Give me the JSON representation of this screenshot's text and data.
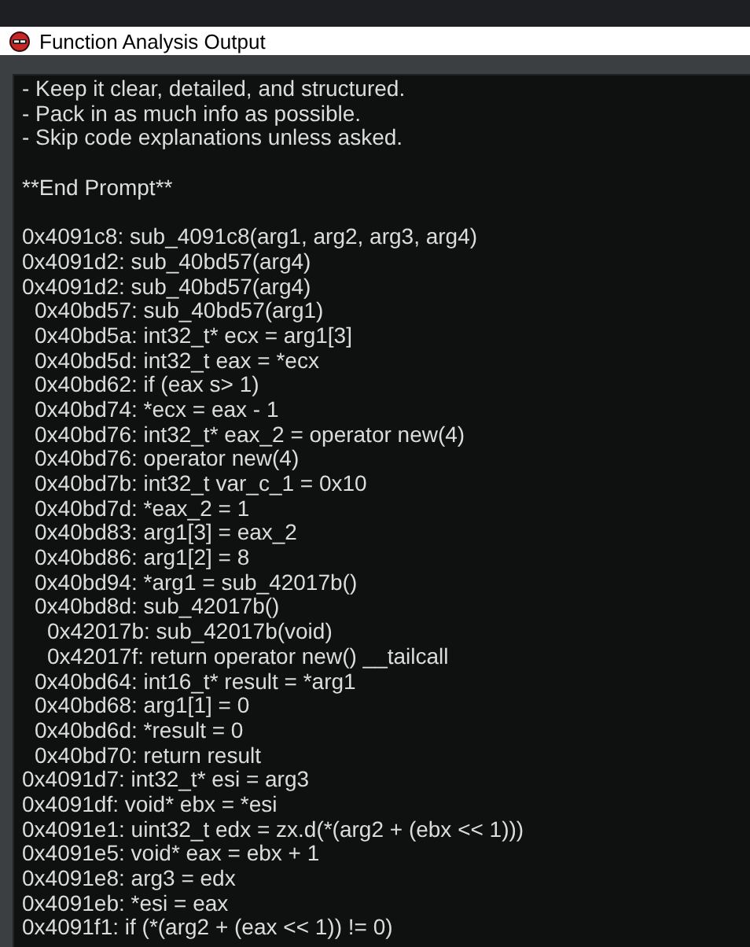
{
  "window": {
    "title": "Function Analysis Output"
  },
  "prompt_lines": [
    "- Keep it clear, detailed, and structured.",
    "- Pack in as much info as possible.",
    "- Skip code explanations unless asked."
  ],
  "end_marker": "**End Prompt**",
  "trace": [
    {
      "text": "0x4091c8: sub_4091c8(arg1, arg2, arg3, arg4)"
    },
    {
      "text": "0x4091d2: sub_40bd57(arg4)"
    },
    {
      "text": "0x4091d2: sub_40bd57(arg4)",
      "children": [
        {
          "text": "0x40bd57: sub_40bd57(arg1)"
        },
        {
          "text": "0x40bd5a: int32_t* ecx = arg1[3]"
        },
        {
          "text": "0x40bd5d: int32_t eax = *ecx"
        },
        {
          "text": "0x40bd62: if (eax s> 1)"
        },
        {
          "text": "0x40bd74: *ecx = eax - 1"
        },
        {
          "text": "0x40bd76: int32_t* eax_2 = operator new(4)"
        },
        {
          "text": "0x40bd76: operator new(4)"
        },
        {
          "text": "0x40bd7b: int32_t var_c_1 = 0x10"
        },
        {
          "text": "0x40bd7d: *eax_2 = 1"
        },
        {
          "text": "0x40bd83: arg1[3] = eax_2"
        },
        {
          "text": "0x40bd86: arg1[2] = 8"
        },
        {
          "text": "0x40bd94: *arg1 = sub_42017b()"
        },
        {
          "text": "0x40bd8d: sub_42017b()",
          "children": [
            {
              "text": "0x42017b: sub_42017b(void)"
            },
            {
              "text": "0x42017f: return operator new() __tailcall"
            }
          ]
        },
        {
          "text": "0x40bd64: int16_t* result = *arg1"
        },
        {
          "text": "0x40bd68: arg1[1] = 0"
        },
        {
          "text": "0x40bd6d: *result = 0"
        },
        {
          "text": "0x40bd70: return result"
        }
      ]
    },
    {
      "text": "0x4091d7: int32_t* esi = arg3"
    },
    {
      "text": "0x4091df: void* ebx = *esi"
    },
    {
      "text": "0x4091e1: uint32_t edx = zx.d(*(arg2 + (ebx << 1)))"
    },
    {
      "text": "0x4091e5: void* eax = ebx + 1"
    },
    {
      "text": "0x4091e8: arg3 = edx"
    },
    {
      "text": "0x4091eb: *esi = eax"
    },
    {
      "text": "0x4091f1: if (*(arg2 + (eax << 1)) != 0)"
    }
  ]
}
